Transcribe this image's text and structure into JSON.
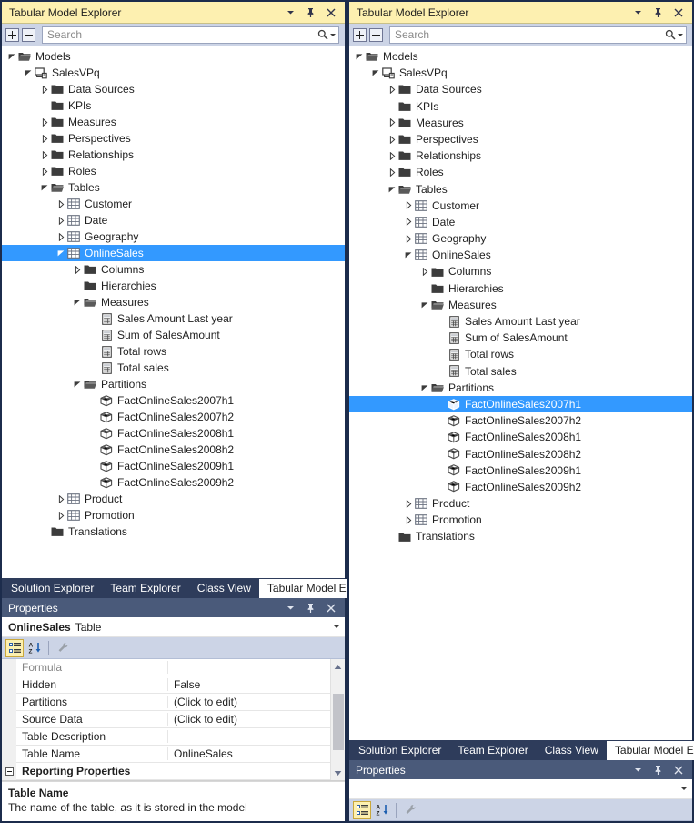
{
  "left": {
    "title": "Tabular Model Explorer",
    "search": {
      "placeholder": "Search",
      "value": ""
    },
    "tree": [
      {
        "indent": 0,
        "expander": "expanded",
        "icon": "folder-open-icon",
        "label": "Models"
      },
      {
        "indent": 1,
        "expander": "expanded",
        "icon": "model-icon",
        "label": "SalesVPq"
      },
      {
        "indent": 2,
        "expander": "collapsed",
        "icon": "folder-icon",
        "label": "Data Sources"
      },
      {
        "indent": 2,
        "expander": "none",
        "icon": "folder-icon",
        "label": "KPIs"
      },
      {
        "indent": 2,
        "expander": "collapsed",
        "icon": "folder-icon",
        "label": "Measures"
      },
      {
        "indent": 2,
        "expander": "collapsed",
        "icon": "folder-icon",
        "label": "Perspectives"
      },
      {
        "indent": 2,
        "expander": "collapsed",
        "icon": "folder-icon",
        "label": "Relationships"
      },
      {
        "indent": 2,
        "expander": "collapsed",
        "icon": "folder-icon",
        "label": "Roles"
      },
      {
        "indent": 2,
        "expander": "expanded",
        "icon": "folder-open-icon",
        "label": "Tables"
      },
      {
        "indent": 3,
        "expander": "collapsed",
        "icon": "table-icon",
        "label": "Customer"
      },
      {
        "indent": 3,
        "expander": "collapsed",
        "icon": "table-icon",
        "label": "Date"
      },
      {
        "indent": 3,
        "expander": "collapsed",
        "icon": "table-icon",
        "label": "Geography"
      },
      {
        "indent": 3,
        "expander": "expanded",
        "icon": "table-icon",
        "label": "OnlineSales",
        "selected": true
      },
      {
        "indent": 4,
        "expander": "collapsed",
        "icon": "folder-icon",
        "label": "Columns"
      },
      {
        "indent": 4,
        "expander": "none",
        "icon": "folder-icon",
        "label": "Hierarchies"
      },
      {
        "indent": 4,
        "expander": "expanded",
        "icon": "folder-open-icon",
        "label": "Measures"
      },
      {
        "indent": 5,
        "expander": "none",
        "icon": "measure-icon",
        "label": "Sales Amount Last year"
      },
      {
        "indent": 5,
        "expander": "none",
        "icon": "measure-icon",
        "label": "Sum of SalesAmount"
      },
      {
        "indent": 5,
        "expander": "none",
        "icon": "measure-icon",
        "label": "Total rows"
      },
      {
        "indent": 5,
        "expander": "none",
        "icon": "measure-icon",
        "label": "Total sales"
      },
      {
        "indent": 4,
        "expander": "expanded",
        "icon": "folder-open-icon",
        "label": "Partitions"
      },
      {
        "indent": 5,
        "expander": "none",
        "icon": "partition-icon",
        "label": "FactOnlineSales2007h1"
      },
      {
        "indent": 5,
        "expander": "none",
        "icon": "partition-icon",
        "label": "FactOnlineSales2007h2"
      },
      {
        "indent": 5,
        "expander": "none",
        "icon": "partition-icon",
        "label": "FactOnlineSales2008h1"
      },
      {
        "indent": 5,
        "expander": "none",
        "icon": "partition-icon",
        "label": "FactOnlineSales2008h2"
      },
      {
        "indent": 5,
        "expander": "none",
        "icon": "partition-icon",
        "label": "FactOnlineSales2009h1"
      },
      {
        "indent": 5,
        "expander": "none",
        "icon": "partition-icon",
        "label": "FactOnlineSales2009h2"
      },
      {
        "indent": 3,
        "expander": "collapsed",
        "icon": "table-icon",
        "label": "Product"
      },
      {
        "indent": 3,
        "expander": "collapsed",
        "icon": "table-icon",
        "label": "Promotion"
      },
      {
        "indent": 2,
        "expander": "none",
        "icon": "folder-icon",
        "label": "Translations"
      }
    ],
    "tabs": [
      {
        "label": "Solution Explorer",
        "active": false
      },
      {
        "label": "Team Explorer",
        "active": false
      },
      {
        "label": "Class View",
        "active": false
      },
      {
        "label": "Tabular Model Expl...",
        "active": true
      }
    ],
    "properties": {
      "title": "Properties",
      "object": "OnlineSales",
      "object_class": "Table",
      "rows": [
        {
          "name": "Formula",
          "value": "",
          "dim": true
        },
        {
          "name": "Hidden",
          "value": "False"
        },
        {
          "name": "Partitions",
          "value": "(Click to edit)"
        },
        {
          "name": "Source Data",
          "value": "(Click to edit)"
        },
        {
          "name": "Table Description",
          "value": ""
        },
        {
          "name": "Table Name",
          "value": "OnlineSales"
        }
      ],
      "category": "Reporting Properties",
      "description_title": "Table Name",
      "description_text": "The name of the table, as it is stored in the model"
    }
  },
  "right": {
    "title": "Tabular Model Explorer",
    "search": {
      "placeholder": "Search",
      "value": ""
    },
    "tree": [
      {
        "indent": 0,
        "expander": "expanded",
        "icon": "folder-open-icon",
        "label": "Models"
      },
      {
        "indent": 1,
        "expander": "expanded",
        "icon": "model-icon",
        "label": "SalesVPq"
      },
      {
        "indent": 2,
        "expander": "collapsed",
        "icon": "folder-icon",
        "label": "Data Sources"
      },
      {
        "indent": 2,
        "expander": "none",
        "icon": "folder-icon",
        "label": "KPIs"
      },
      {
        "indent": 2,
        "expander": "collapsed",
        "icon": "folder-icon",
        "label": "Measures"
      },
      {
        "indent": 2,
        "expander": "collapsed",
        "icon": "folder-icon",
        "label": "Perspectives"
      },
      {
        "indent": 2,
        "expander": "collapsed",
        "icon": "folder-icon",
        "label": "Relationships"
      },
      {
        "indent": 2,
        "expander": "collapsed",
        "icon": "folder-icon",
        "label": "Roles"
      },
      {
        "indent": 2,
        "expander": "expanded",
        "icon": "folder-open-icon",
        "label": "Tables"
      },
      {
        "indent": 3,
        "expander": "collapsed",
        "icon": "table-icon",
        "label": "Customer"
      },
      {
        "indent": 3,
        "expander": "collapsed",
        "icon": "table-icon",
        "label": "Date"
      },
      {
        "indent": 3,
        "expander": "collapsed",
        "icon": "table-icon",
        "label": "Geography"
      },
      {
        "indent": 3,
        "expander": "expanded",
        "icon": "table-icon",
        "label": "OnlineSales"
      },
      {
        "indent": 4,
        "expander": "collapsed",
        "icon": "folder-icon",
        "label": "Columns"
      },
      {
        "indent": 4,
        "expander": "none",
        "icon": "folder-icon",
        "label": "Hierarchies"
      },
      {
        "indent": 4,
        "expander": "expanded",
        "icon": "folder-open-icon",
        "label": "Measures"
      },
      {
        "indent": 5,
        "expander": "none",
        "icon": "measure-icon",
        "label": "Sales Amount Last year"
      },
      {
        "indent": 5,
        "expander": "none",
        "icon": "measure-icon",
        "label": "Sum of SalesAmount"
      },
      {
        "indent": 5,
        "expander": "none",
        "icon": "measure-icon",
        "label": "Total rows"
      },
      {
        "indent": 5,
        "expander": "none",
        "icon": "measure-icon",
        "label": "Total sales"
      },
      {
        "indent": 4,
        "expander": "expanded",
        "icon": "folder-open-icon",
        "label": "Partitions"
      },
      {
        "indent": 5,
        "expander": "none",
        "icon": "partition-icon",
        "label": "FactOnlineSales2007h1",
        "selected": true
      },
      {
        "indent": 5,
        "expander": "none",
        "icon": "partition-icon",
        "label": "FactOnlineSales2007h2"
      },
      {
        "indent": 5,
        "expander": "none",
        "icon": "partition-icon",
        "label": "FactOnlineSales2008h1"
      },
      {
        "indent": 5,
        "expander": "none",
        "icon": "partition-icon",
        "label": "FactOnlineSales2008h2"
      },
      {
        "indent": 5,
        "expander": "none",
        "icon": "partition-icon",
        "label": "FactOnlineSales2009h1"
      },
      {
        "indent": 5,
        "expander": "none",
        "icon": "partition-icon",
        "label": "FactOnlineSales2009h2"
      },
      {
        "indent": 3,
        "expander": "collapsed",
        "icon": "table-icon",
        "label": "Product"
      },
      {
        "indent": 3,
        "expander": "collapsed",
        "icon": "table-icon",
        "label": "Promotion"
      },
      {
        "indent": 2,
        "expander": "none",
        "icon": "folder-icon",
        "label": "Translations"
      }
    ],
    "tabs": [
      {
        "label": "Solution Explorer",
        "active": false
      },
      {
        "label": "Team Explorer",
        "active": false
      },
      {
        "label": "Class View",
        "active": false
      },
      {
        "label": "Tabular Model Expl...",
        "active": true
      }
    ],
    "properties": {
      "title": "Properties",
      "object": "",
      "object_class": "",
      "rows": [],
      "category": "",
      "description_title": "",
      "description_text": ""
    }
  },
  "colors": {
    "title_bar": "#fdf0b0",
    "selection": "#3399ff",
    "toolbar": "#ccd4e6",
    "tab_strip": "#2e3c5b",
    "props_header": "#4a5a7a",
    "panel_border": "#1c2c4c"
  },
  "icons": {
    "dropdown": "chevron-down-icon",
    "pin": "pin-icon",
    "close": "close-icon",
    "search": "magnifier-icon",
    "expand_all": "expand-all-icon",
    "collapse_all": "collapse-all-icon",
    "categorized": "categorized-view-icon",
    "alphabetical": "alphabetical-sort-icon",
    "property_pages": "property-pages-icon"
  }
}
